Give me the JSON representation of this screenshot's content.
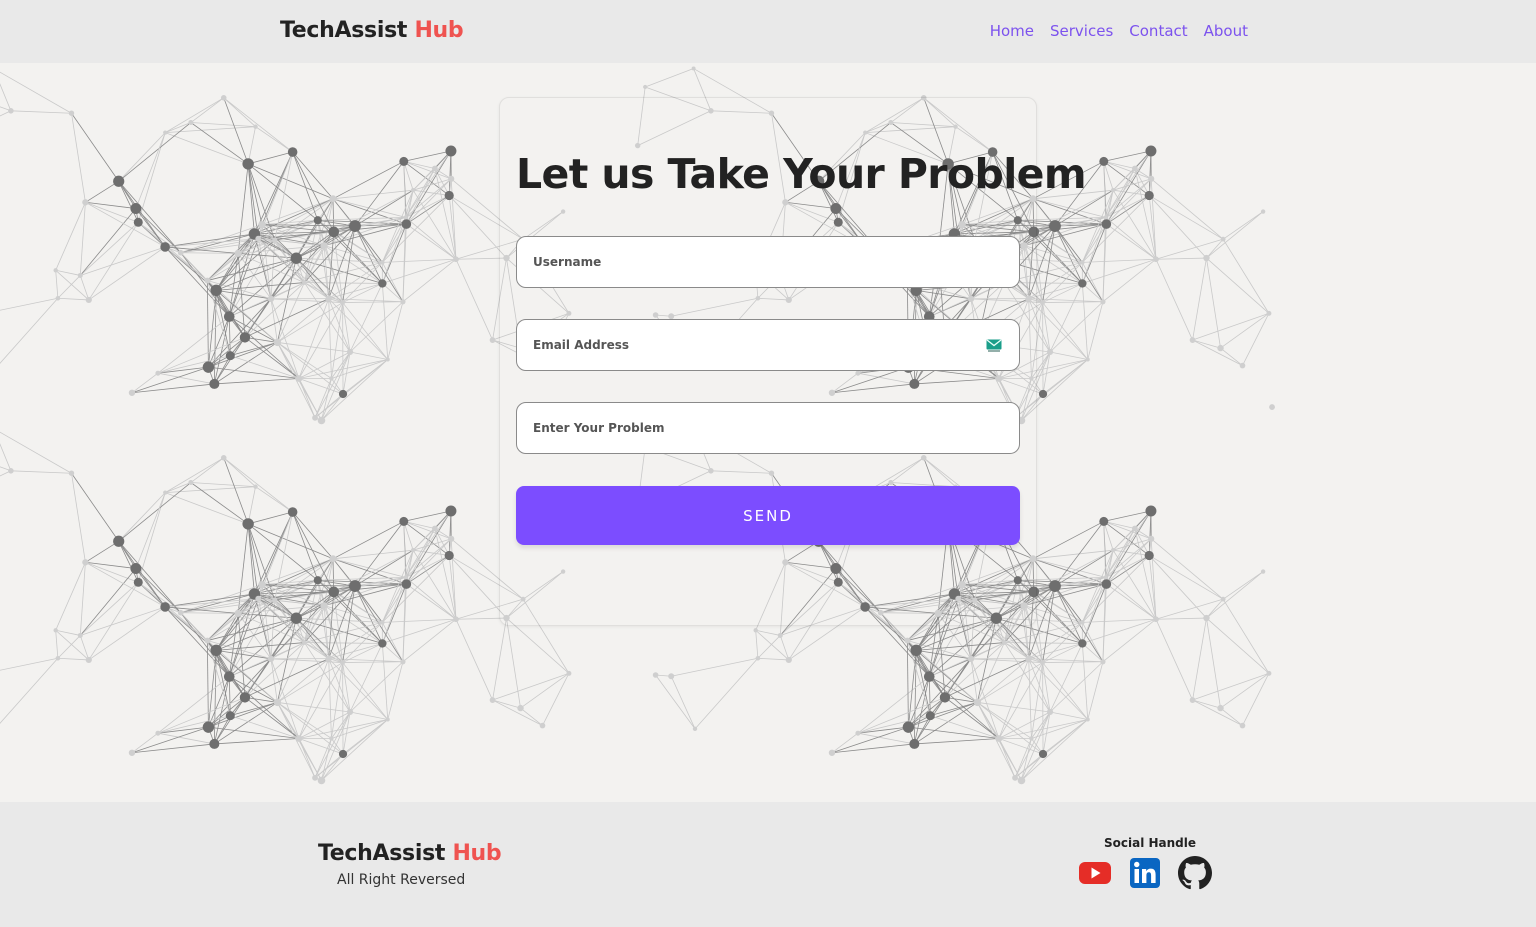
{
  "header": {
    "brand_main": "TechAssist ",
    "brand_accent": "Hub",
    "nav": [
      "Home",
      "Services",
      "Contact",
      "About"
    ]
  },
  "form": {
    "heading": "Let us Take Your Problem",
    "username_placeholder": "Username",
    "email_placeholder": "Email Address",
    "problem_placeholder": "Enter Your Problem",
    "send_label": "SEND"
  },
  "footer": {
    "brand_main": "TechAssist ",
    "brand_accent": "Hub",
    "copyright": "All Right Reversed",
    "social_title": "Social Handle",
    "social_icons": [
      "youtube-icon",
      "linkedin-icon",
      "github-icon"
    ]
  },
  "colors": {
    "accent_red": "#ef5350",
    "link_purple": "#7c52ee",
    "button_purple": "#7c4dff",
    "youtube_red": "#e52d27",
    "linkedin_blue": "#0a66c2"
  }
}
